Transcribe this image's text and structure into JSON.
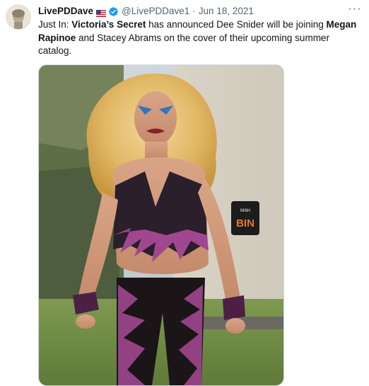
{
  "tweet": {
    "author_name": "LivePDDave",
    "author_flag": "us-flag-icon",
    "verified": true,
    "handle": "@LivePDDave1",
    "separator": "·",
    "date": "Jun 18, 2021",
    "more_icon": "more-dots-icon",
    "text_parts": {
      "p1": "Just In: ",
      "b1": "Victoria’s Secret",
      "p2": " has announced Dee Snider will be joining ",
      "b2": "Megan Rapinoe",
      "p3": " and Stacey Abrams on the cover of their upcoming summer catalog."
    },
    "media": {
      "sign_text": "BIN",
      "sign_text_top": "ман"
    }
  },
  "colors": {
    "text_primary": "#0f1419",
    "text_secondary": "#536471",
    "verified_blue": "#1d9bf0",
    "media_border": "#cfd9de"
  }
}
